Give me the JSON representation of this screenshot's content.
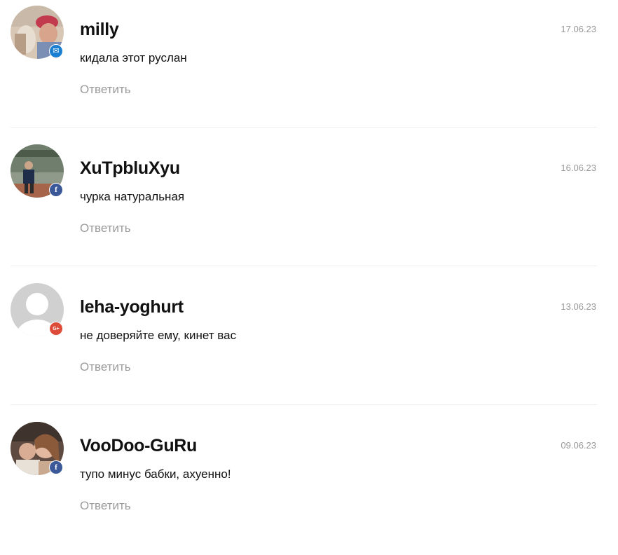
{
  "reply_label": "Ответить",
  "colors": {
    "date": "#999999",
    "reply": "#9a9a9a",
    "divider": "#eeeeee",
    "mail_badge": "#1a7fd1",
    "facebook_badge": "#3b5998",
    "google_plus_badge": "#dd4b39"
  },
  "comments": [
    {
      "author": "milly",
      "date": "17.06.23",
      "text": "кидала этот руслан",
      "badge_icon": "mail-icon",
      "badge_glyph": "✉",
      "avatar_type": "photo"
    },
    {
      "author": "XuTpbluXyu",
      "date": "16.06.23",
      "text": "чурка натуральная",
      "badge_icon": "facebook-icon",
      "badge_glyph": "f",
      "avatar_type": "photo"
    },
    {
      "author": "leha-yoghurt",
      "date": "13.06.23",
      "text": "не доверяйте ему, кинет вас",
      "badge_icon": "google-plus-icon",
      "badge_glyph": "G+",
      "avatar_type": "default-silhouette"
    },
    {
      "author": "VooDoo-GuRu",
      "date": "09.06.23",
      "text": "тупо минус бабки, ахуенно!",
      "badge_icon": "facebook-icon",
      "badge_glyph": "f",
      "avatar_type": "photo"
    }
  ]
}
